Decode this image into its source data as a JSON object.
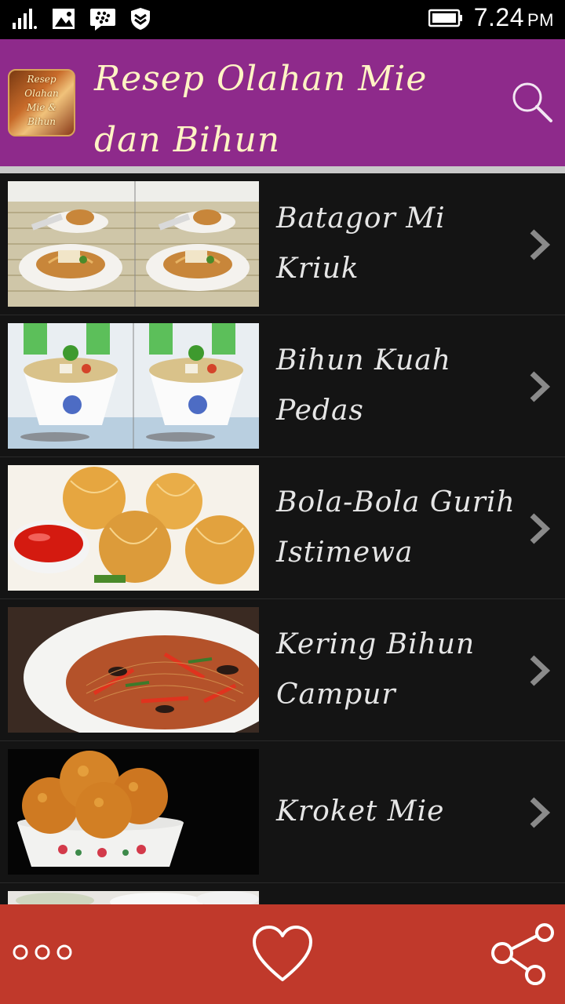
{
  "status_bar": {
    "time": "7.24",
    "ampm": "PM",
    "icons": [
      "signal-icon",
      "image-notification-icon",
      "bbm-icon",
      "shield-icon",
      "battery-icon"
    ]
  },
  "app_bar": {
    "title_line1": "Resep Olahan Mie",
    "title_line2": "dan Bihun",
    "logo_text": [
      "Resep",
      "Olahan",
      "Mie &",
      "Bihun"
    ],
    "background_color": "#8e2a8b",
    "title_color": "#fff4c4",
    "search_icon": "search-icon"
  },
  "recipes": [
    {
      "line1": "Batagor Mi",
      "line2": "Kriuk"
    },
    {
      "line1": "Bihun Kuah",
      "line2": "Pedas"
    },
    {
      "line1": "Bola-Bola Gurih",
      "line2": "Istimewa"
    },
    {
      "line1": "Kering Bihun",
      "line2": "Campur"
    },
    {
      "line1": "Kroket Mie",
      "line2": ""
    }
  ],
  "bottom_bar": {
    "background_color": "#c0392b",
    "icons": [
      "more-icon",
      "heart-icon",
      "share-icon"
    ]
  }
}
